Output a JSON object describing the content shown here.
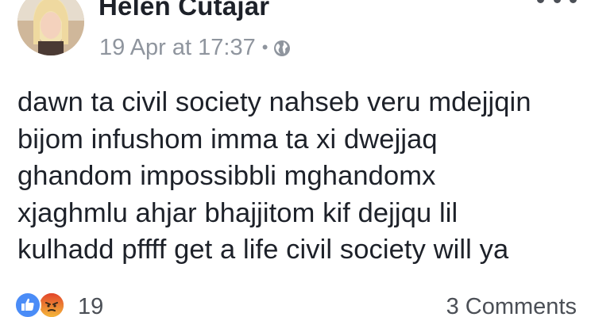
{
  "post": {
    "author": {
      "name": "Helen Cutajar",
      "avatar_icon": "profile-photo"
    },
    "meta": {
      "timestamp": "19 Apr at 17:37",
      "separator": "•",
      "privacy_icon": "globe-icon"
    },
    "menu_icon": "more-options-icon",
    "text": "dawn ta civil society nahseb veru mdejjqin\nbijom infushom imma ta xi dwejjaq\nghandom impossibbli mghandomx\nxjaghmlu ahjar bhajjitom kif dejjqu lil\nkulhadd pffff get a life civil society will ya",
    "reactions": {
      "icons": [
        "like-icon",
        "angry-icon"
      ],
      "count": "19"
    },
    "comments": {
      "label": "3 Comments"
    }
  },
  "colors": {
    "name": "#1d2129",
    "meta": "#8f959e",
    "like": "#4a8cf7",
    "angry": "#ea6a3b",
    "footer_text": "#4b4f56"
  }
}
